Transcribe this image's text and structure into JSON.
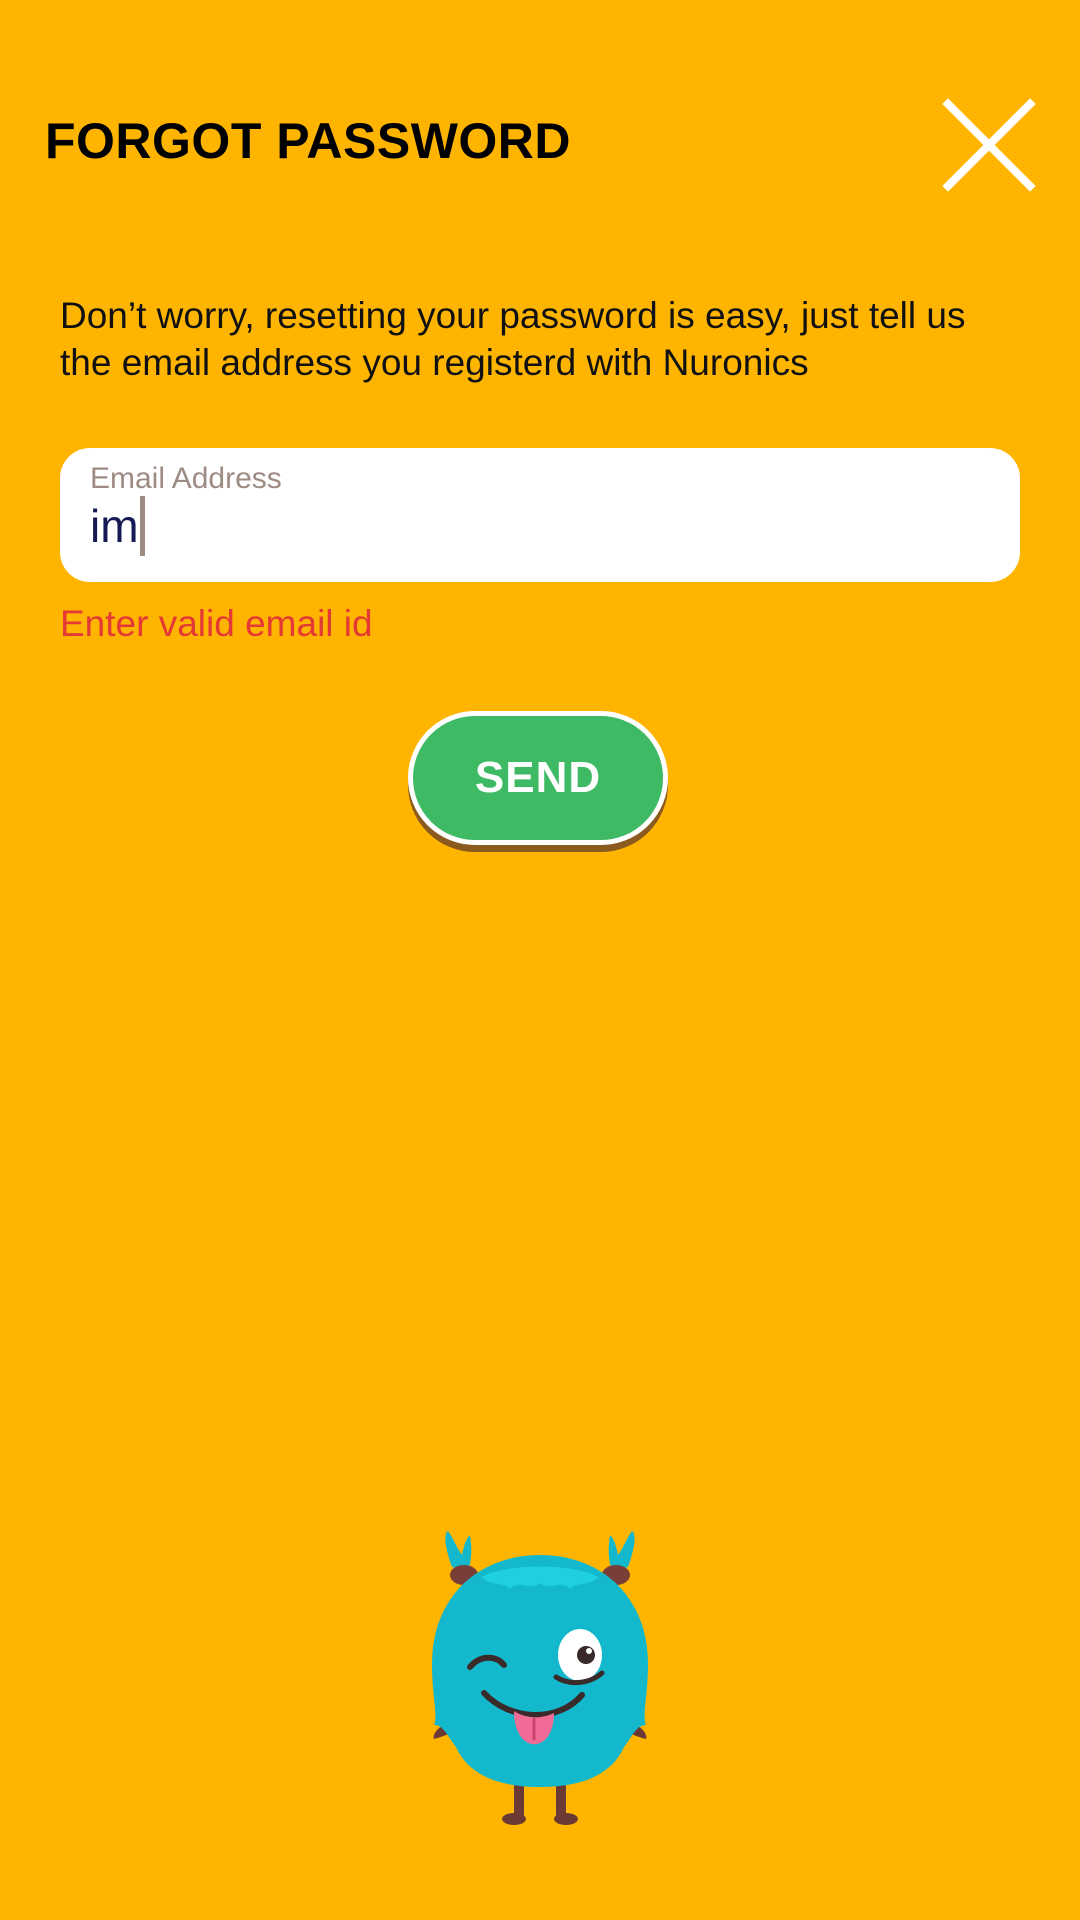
{
  "header": {
    "title": "FORGOT PASSWORD",
    "close_icon": "close-icon"
  },
  "main": {
    "description": "Don’t worry, resetting your password is easy, just tell us the email address you registerd with Nuronics",
    "email_field": {
      "label": "Email Address",
      "value": "im"
    },
    "error_message": "Enter valid email id",
    "send_label": "SEND"
  },
  "mascot": {
    "icon": "monster-mascot-icon"
  },
  "colors": {
    "background": "#FFB500",
    "send_button": "#3DBA63",
    "error": "#E53935",
    "mascot": "#14B8CC"
  }
}
